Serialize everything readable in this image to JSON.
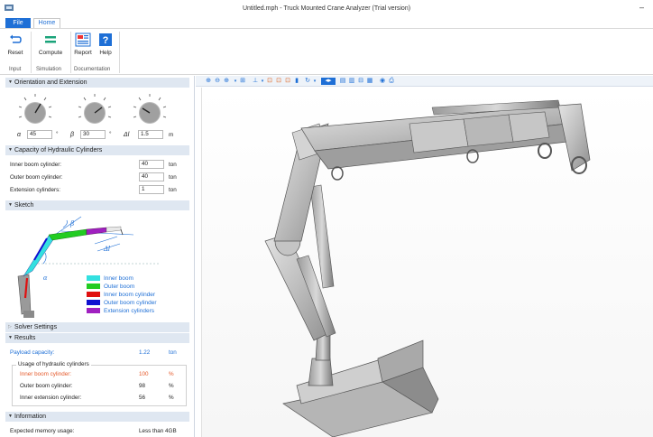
{
  "window": {
    "title": "Untitled.mph - Truck Mounted Crane Analyzer (Trial version)",
    "minimize": "–"
  },
  "tabs": {
    "file": "File",
    "home": "Home"
  },
  "ribbon": {
    "reset": "Reset",
    "compute": "Compute",
    "report": "Report",
    "help": "Help",
    "groups": {
      "input": "Input",
      "simulation": "Simulation",
      "documentation": "Documentation"
    }
  },
  "orientation": {
    "header": "Orientation and Extension",
    "alpha_symbol": "α",
    "alpha_value": "45",
    "alpha_unit": "°",
    "beta_symbol": "β",
    "beta_value": "30",
    "beta_unit": "°",
    "dl_symbol": "Δl",
    "dl_value": "1.5",
    "dl_unit": "m"
  },
  "capacity": {
    "header": "Capacity of Hydraulic Cylinders",
    "rows": [
      {
        "label": "Inner boom cylinder:",
        "value": "40",
        "unit": "ton"
      },
      {
        "label": "Outer boom cylinder:",
        "value": "40",
        "unit": "ton"
      },
      {
        "label": "Extension cylinders:",
        "value": "1",
        "unit": "ton"
      }
    ]
  },
  "sketch": {
    "header": "Sketch",
    "beta": "β",
    "alpha": "α",
    "dl": "Δl",
    "legend": [
      {
        "label": "Inner boom",
        "color": "#33e0e0"
      },
      {
        "label": "Outer boom",
        "color": "#22cc22"
      },
      {
        "label": "Inner boom cylinder",
        "color": "#e01010"
      },
      {
        "label": "Outer boom cylinder",
        "color": "#1010d0"
      },
      {
        "label": "Extension cylinders",
        "color": "#a020c0"
      }
    ]
  },
  "solver": {
    "header": "Solver Settings"
  },
  "results": {
    "header": "Results",
    "payload_label": "Payload capacity:",
    "payload_value": "1.22",
    "payload_unit": "ton",
    "usage_label": "Usage of hydraulic cylinders",
    "rows": [
      {
        "label": "Inner boom cylinder:",
        "value": "100",
        "unit": "%"
      },
      {
        "label": "Outer boom cylinder:",
        "value": "98",
        "unit": "%"
      },
      {
        "label": "Inner extension cylinder:",
        "value": "56",
        "unit": "%"
      }
    ]
  },
  "information": {
    "header": "Information",
    "memory_label": "Expected memory usage:",
    "memory_value": "Less than 4GB"
  }
}
